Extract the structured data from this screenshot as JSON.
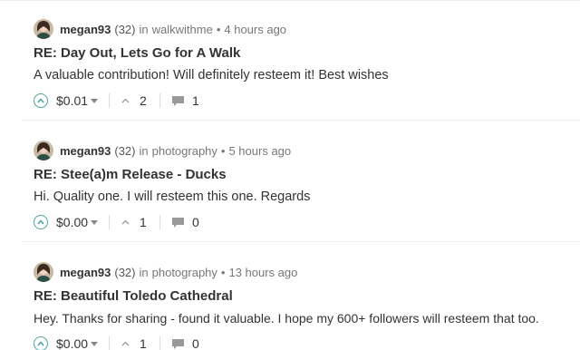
{
  "colors": {
    "accent": "#4ba2a2",
    "text": "#333333",
    "muted": "#777777",
    "divider": "#eeeeee"
  },
  "comments": [
    {
      "author": "megan93",
      "reputation": "(32)",
      "in_label": "in",
      "community": "walkwithme",
      "separator": "•",
      "time": "4 hours ago",
      "title": "RE: Day Out, Lets Go for A Walk",
      "body": "A valuable contribution! Will definitely resteem it! Best wishes",
      "payout": "$0.01",
      "votes": "2",
      "replies": "1",
      "icons": [
        "upvote-icon",
        "caret-down-icon",
        "chevron-up-icon",
        "comment-icon"
      ]
    },
    {
      "author": "megan93",
      "reputation": "(32)",
      "in_label": "in",
      "community": "photography",
      "separator": "•",
      "time": "5 hours ago",
      "title": "RE: Stee(a)m Release - Ducks",
      "body": "Hi. Quality one. I will resteem this one. Regards",
      "payout": "$0.00",
      "votes": "1",
      "replies": "0",
      "icons": [
        "upvote-icon",
        "caret-down-icon",
        "chevron-up-icon",
        "comment-icon"
      ]
    },
    {
      "author": "megan93",
      "reputation": "(32)",
      "in_label": "in",
      "community": "photography",
      "separator": "•",
      "time": "13 hours ago",
      "title": "RE: Beautiful Toledo Cathedral",
      "body": "Hey. Thanks for sharing - found it valuable. I hope my 600+ followers will resteem that too.",
      "payout": "$0.00",
      "votes": "1",
      "replies": "0",
      "icons": [
        "upvote-icon",
        "caret-down-icon",
        "chevron-up-icon",
        "comment-icon"
      ]
    }
  ]
}
